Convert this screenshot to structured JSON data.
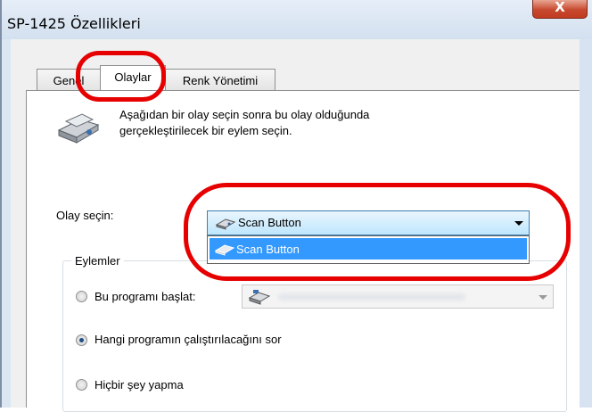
{
  "window": {
    "title": "SP-1425 Özellikleri",
    "close_glyph": "X"
  },
  "tabs": [
    {
      "label": "Genel"
    },
    {
      "label": "Olaylar"
    },
    {
      "label": "Renk Yönetimi"
    }
  ],
  "intro": {
    "line1": "Aşağıdan bir olay seçin sonra bu olay olduğunda",
    "line2": "gerçekleştirilecek bir eylem seçin.",
    "icon": "scanner-icon"
  },
  "event": {
    "label": "Olay seçin:",
    "selected": "Scan Button",
    "options": [
      "Scan Button"
    ]
  },
  "actions": {
    "group_label": "Eylemler",
    "options": [
      {
        "label": "Bu programı başlat:",
        "checked": false
      },
      {
        "label": "Hangi programın çalıştırılacağını sor",
        "checked": true
      },
      {
        "label": "Hiçbir şey yapma",
        "checked": false
      }
    ]
  },
  "colors": {
    "highlight_ring": "#e60000",
    "selection": "#3399ff",
    "combo_border": "#3c7fb1"
  }
}
